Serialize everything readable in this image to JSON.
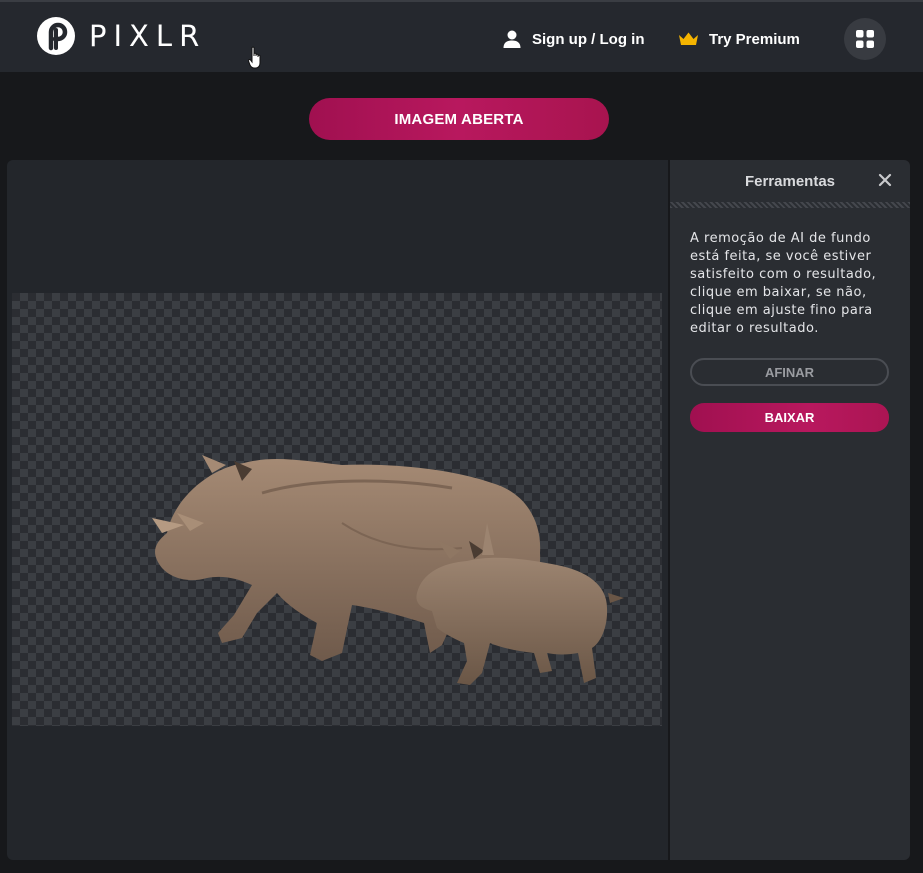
{
  "header": {
    "logo_text": "PIXLR",
    "sign_in_label": "Sign up / Log in",
    "premium_label": "Try Premium",
    "premium_icon": "crown-icon",
    "apps_icon": "apps-grid-icon",
    "user_icon": "user-icon"
  },
  "actions": {
    "open_image_label": "IMAGEM ABERTA"
  },
  "tools_panel": {
    "title": "Ferramentas",
    "close_icon": "close-icon",
    "description": "A remoção de AI de fundo está feita, se você estiver satisfeito com o resultado, clique em baixar, se não, clique em ajuste fino para editar o resultado.",
    "refine_label": "AFINAR",
    "download_label": "BAIXAR"
  },
  "colors": {
    "accent": "#b0165a",
    "header_bg": "#25282e",
    "page_bg": "#17181b",
    "panel_bg": "#2a2d32",
    "crown": "#f5b400"
  }
}
